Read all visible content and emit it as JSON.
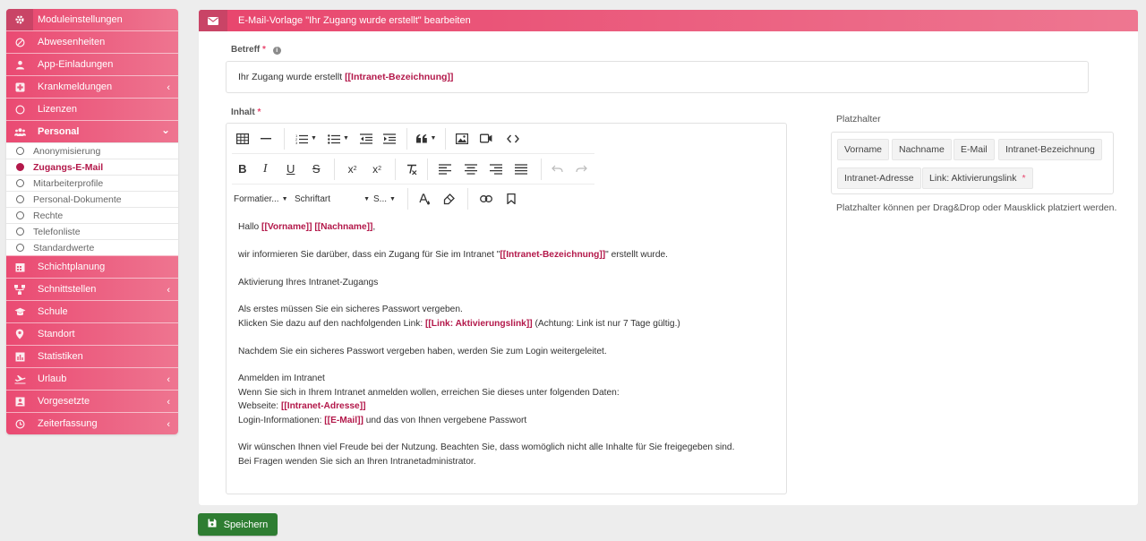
{
  "sidebar": {
    "header": "Moduleinstellungen",
    "items": [
      {
        "label": "Abwesenheiten",
        "icon": "block-icon",
        "chevron": ""
      },
      {
        "label": "App-Einladungen",
        "icon": "user-icon",
        "chevron": ""
      },
      {
        "label": "Krankmeldungen",
        "icon": "medical-icon",
        "chevron": "‹"
      },
      {
        "label": "Lizenzen",
        "icon": "circle-icon",
        "chevron": ""
      },
      {
        "label": "Personal",
        "icon": "users-icon",
        "chevron": "⌄"
      }
    ],
    "subitems": [
      {
        "label": "Anonymisierung"
      },
      {
        "label": "Zugangs-E-Mail"
      },
      {
        "label": "Mitarbeiterprofile"
      },
      {
        "label": "Personal-Dokumente"
      },
      {
        "label": "Rechte"
      },
      {
        "label": "Telefonliste"
      },
      {
        "label": "Standardwerte"
      }
    ],
    "items_after": [
      {
        "label": "Schichtplanung",
        "icon": "calendar-icon",
        "chevron": ""
      },
      {
        "label": "Schnittstellen",
        "icon": "network-icon",
        "chevron": "‹"
      },
      {
        "label": "Schule",
        "icon": "graduation-icon",
        "chevron": ""
      },
      {
        "label": "Standort",
        "icon": "map-pin-icon",
        "chevron": ""
      },
      {
        "label": "Statistiken",
        "icon": "chart-icon",
        "chevron": ""
      },
      {
        "label": "Urlaub",
        "icon": "plane-icon",
        "chevron": "‹"
      },
      {
        "label": "Vorgesetzte",
        "icon": "id-card-icon",
        "chevron": "‹"
      },
      {
        "label": "Zeiterfassung",
        "icon": "clock-icon",
        "chevron": "‹"
      }
    ]
  },
  "panel": {
    "title": "E-Mail-Vorlage \"Ihr Zugang wurde erstellt\" bearbeiten"
  },
  "subject": {
    "label": "Betreff",
    "required_mark": "*",
    "text": "Ihr Zugang wurde erstellt ",
    "placeholder_token": "[[Intranet-Bezeichnung]]"
  },
  "content": {
    "label": "Inhalt",
    "required_mark": "*",
    "toolbar": {
      "format_label": "Formatier...",
      "font_label": "Schriftart",
      "size_label": "S..."
    },
    "body": {
      "greet_pre": "Hallo ",
      "greet_tok1": "[[Vorname]]",
      "greet_sp": " ",
      "greet_tok2": "[[Nachname]]",
      "greet_post": ",",
      "p2_pre": "wir informieren Sie darüber, dass ein Zugang für Sie im Intranet \"",
      "p2_tok": "[[Intranet-Bezeichnung]]",
      "p2_post": "\" erstellt wurde.",
      "p3": "Aktivierung Ihres Intranet-Zugangs",
      "p4_l1": "Als erstes müssen Sie ein sicheres Passwort vergeben.",
      "p4_l2_pre": "Klicken Sie dazu auf den nachfolgenden Link: ",
      "p4_l2_tok": "[[Link: Aktivierungslink]]",
      "p4_l2_post": " (Achtung: Link ist nur 7 Tage gültig.)",
      "p5": "Nachdem Sie ein sicheres Passwort vergeben haben, werden Sie zum Login weitergeleitet.",
      "p6_l1": "Anmelden im Intranet",
      "p6_l2": "Wenn Sie sich in Ihrem Intranet anmelden wollen, erreichen Sie dieses unter folgenden Daten:",
      "p6_l3_pre": "Webseite: ",
      "p6_l3_tok": "[[Intranet-Adresse]]",
      "p6_l4_pre": "Login-Informationen: ",
      "p6_l4_tok": "[[E-Mail]]",
      "p6_l4_post": " und das von Ihnen vergebene Passwort",
      "p7_l1": "Wir wünschen Ihnen viel Freude bei der Nutzung. Beachten Sie, dass womöglich nicht alle Inhalte für Sie freigegeben sind.",
      "p7_l2": "Bei Fragen wenden Sie sich an Ihren Intranetadministrator."
    }
  },
  "placeholders": {
    "title": "Platzhalter",
    "chips": [
      "Vorname",
      "Nachname",
      "E-Mail",
      "Intranet-Bezeichnung",
      "Intranet-Adresse",
      "Link: Aktivierungslink"
    ],
    "link_required_mark": "*",
    "hint": "Platzhalter können per Drag&Drop oder Mausklick platziert werden."
  },
  "save_button": {
    "label": "Speichern"
  },
  "colors": {
    "brand": "#e8456d",
    "placeholder_token": "#b3184a",
    "save": "#2e7d32"
  }
}
